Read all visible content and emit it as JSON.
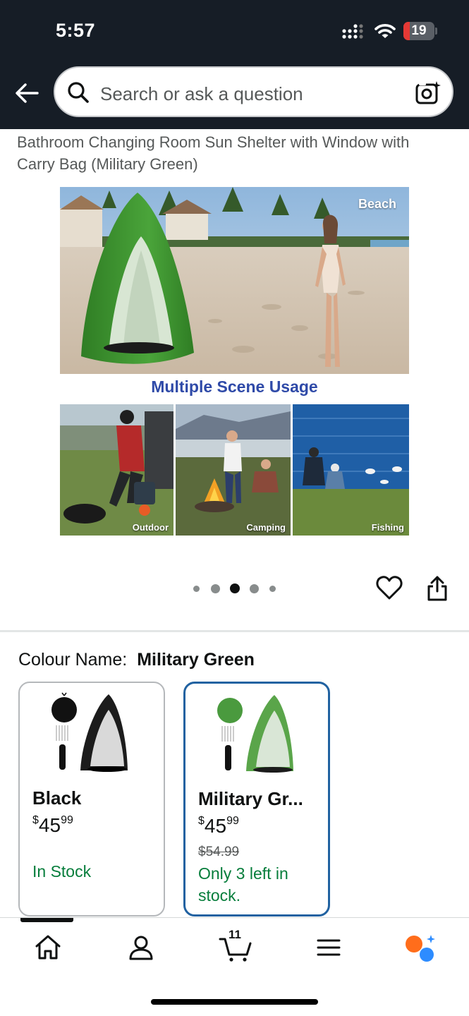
{
  "status_bar": {
    "time": "5:57",
    "battery": "19",
    "battery_color": "#e53935"
  },
  "search": {
    "placeholder": "Search or ask a question"
  },
  "product": {
    "title_lines": "Bathroom Changing Room Sun Shelter with Window with Carry Bag (Military Green)"
  },
  "gallery": {
    "hero_caption": "Beach",
    "scene_heading": "Multiple Scene Usage",
    "thumbs": [
      {
        "caption": "Outdoor"
      },
      {
        "caption": "Camping"
      },
      {
        "caption": "Fishing"
      }
    ],
    "dot_count": 5,
    "active_dot": 3
  },
  "colour": {
    "label": "Colour Name:",
    "selected": "Military Green",
    "options": [
      {
        "name": "Black",
        "currency": "$",
        "price_whole": "45",
        "price_cents": "99",
        "was": "",
        "stock": "In Stock",
        "selected": false
      },
      {
        "name": "Military Gr...",
        "currency": "$",
        "price_whole": "45",
        "price_cents": "99",
        "was": "$54.99",
        "stock": "Only 3 left in stock.",
        "selected": true
      }
    ]
  },
  "nav": {
    "items": [
      "home-icon",
      "account-icon",
      "cart-icon",
      "menu-icon",
      "rufus-icon"
    ],
    "cart_count": "11",
    "accent_orange": "#ff6d1b",
    "accent_blue": "#2d8cff"
  },
  "colors": {
    "header_bg": "#161d26",
    "link_blue": "#2f4aa8",
    "stock_green": "#067d3b",
    "selected_border": "#2162a1"
  }
}
